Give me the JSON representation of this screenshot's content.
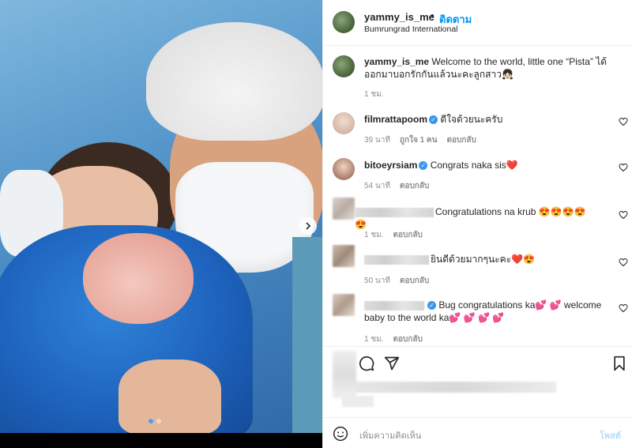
{
  "post": {
    "username": "yammy_is_me",
    "dot": "•",
    "follow_label": "ติดตาม",
    "location": "Bumrungrad International"
  },
  "caption": {
    "username": "yammy_is_me",
    "text": "Welcome to the world, little one “Pista” ได้ออกมาบอกรักกันแล้วนะคะลูกสาว👧🏻",
    "time": "1 ชม."
  },
  "comments": [
    {
      "username": "filmrattapoom",
      "verified": true,
      "text": "ดีใจด้วยนะครับ",
      "time": "39 นาที",
      "likes": "ถูกใจ 1 คน",
      "reply": "ตอบกลับ"
    },
    {
      "username": "bitoeyrsiam",
      "verified": true,
      "text": "Congrats naka sis❤️",
      "time": "54 นาที",
      "likes": "",
      "reply": "ตอบกลับ"
    },
    {
      "username": "",
      "verified": false,
      "text": "Congratulations na krub 😍😍😍😍😍",
      "time": "1 ชม.",
      "likes": "",
      "reply": "ตอบกลับ"
    },
    {
      "username": "",
      "verified": false,
      "text": "ยินดีด้วยมากๆนะคะ❤️😍",
      "time": "50 นาที",
      "likes": "",
      "reply": "ตอบกลับ"
    },
    {
      "username": "",
      "verified": true,
      "text": "Bug congratulations ka💕 💕 welcome baby to the world ka💕 💕 💕 💕",
      "time": "1 ชม.",
      "likes": "",
      "reply": "ตอบกลับ"
    }
  ],
  "comment_box": {
    "placeholder": "เพิ่มความคิดเห็น",
    "post_label": "โพสต์"
  },
  "icons": {
    "next": "chevron-right-icon",
    "comment": "comment-icon",
    "share": "share-icon",
    "save": "bookmark-icon",
    "heart": "heart-outline-icon",
    "emoji": "emoji-icon"
  },
  "colors": {
    "accent": "#0095f6",
    "verified": "#3897f0",
    "muted": "#8e8e8e",
    "post_disabled": "#b2dffc"
  },
  "carousel": {
    "count": 2,
    "current": 1
  }
}
